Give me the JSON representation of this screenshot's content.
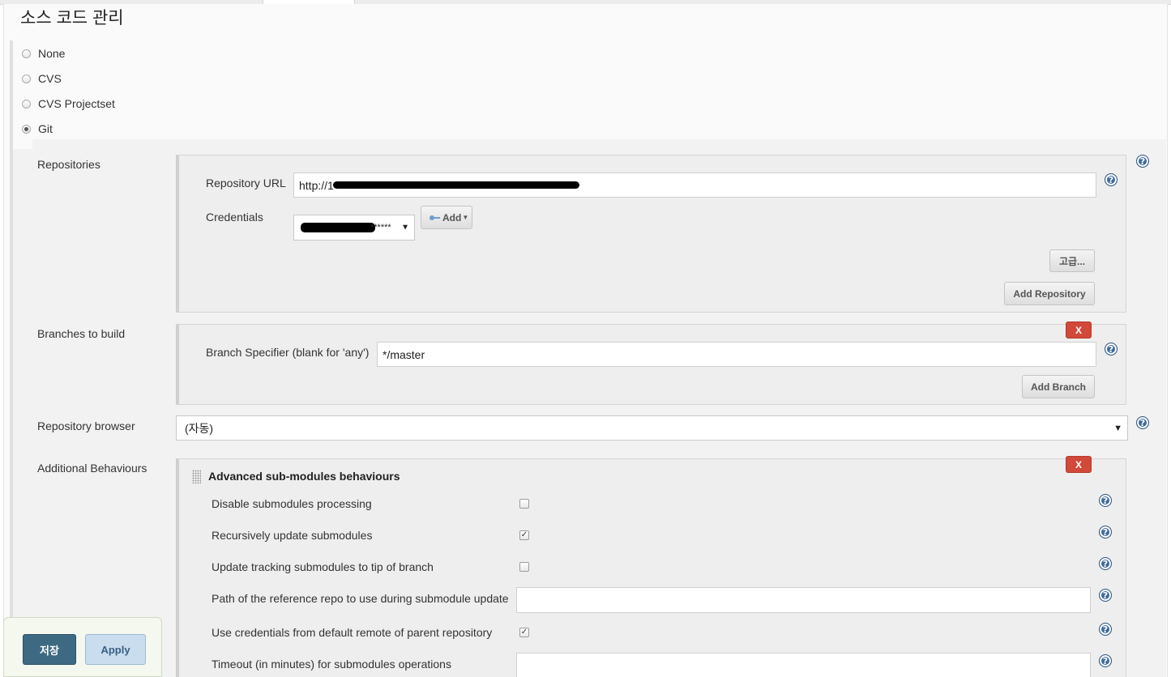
{
  "section": {
    "title": "소스 코드 관리"
  },
  "scm_options": [
    {
      "label": "None",
      "selected": false
    },
    {
      "label": "CVS",
      "selected": false
    },
    {
      "label": "CVS Projectset",
      "selected": false
    },
    {
      "label": "Git",
      "selected": true
    }
  ],
  "repositories": {
    "label": "Repositories",
    "url_label": "Repository URL",
    "url_value_prefix": "http://1",
    "credentials_label": "Credentials",
    "credentials_value_suffix": "******",
    "add_label": "Add",
    "advanced_label": "고급...",
    "add_repository_label": "Add Repository"
  },
  "branches": {
    "label": "Branches to build",
    "specifier_label": "Branch Specifier (blank for 'any')",
    "specifier_value": "*/master",
    "delete_label": "X",
    "add_branch_label": "Add Branch"
  },
  "repo_browser": {
    "label": "Repository browser",
    "selected": "(자동)"
  },
  "behaviours": {
    "label": "Additional Behaviours",
    "title": "Advanced sub-modules behaviours",
    "delete_label": "X",
    "items": [
      {
        "label": "Disable submodules processing",
        "type": "checkbox",
        "checked": false
      },
      {
        "label": "Recursively update submodules",
        "type": "checkbox",
        "checked": true
      },
      {
        "label": "Update tracking submodules to tip of branch",
        "type": "checkbox",
        "checked": false
      },
      {
        "label": "Path of the reference repo to use during submodule update",
        "type": "text",
        "value": ""
      },
      {
        "label": "Use credentials from default remote of parent repository",
        "type": "checkbox",
        "checked": true
      },
      {
        "label": "Timeout (in minutes) for submodules operations",
        "type": "text",
        "value": ""
      }
    ]
  },
  "footer": {
    "save_label": "저장",
    "apply_label": "Apply"
  },
  "icons": {
    "help": "help-icon",
    "key": "key-icon",
    "caret": "caret-down-icon"
  },
  "colors": {
    "help_blue": "#3d6a9b",
    "delete_red": "#d24939",
    "save_blue": "#3d6a82",
    "apply_blue": "#c9ddee"
  }
}
